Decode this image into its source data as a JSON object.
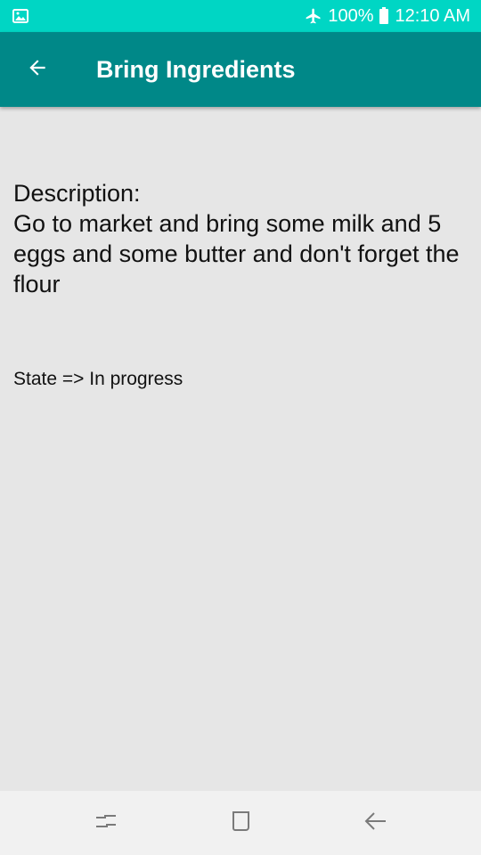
{
  "status_bar": {
    "battery_percent": "100%",
    "time": "12:10 AM",
    "icons": [
      "image-notification-icon",
      "airplane-mode-icon",
      "battery-icon"
    ]
  },
  "app_bar": {
    "title": "Bring Ingredients",
    "back_icon": "arrow-left-icon"
  },
  "task": {
    "description_label": "Description:",
    "description": "Go to market and bring some milk and 5 eggs and some butter and don't forget the flour",
    "state": "State => In progress"
  },
  "nav_bar": {
    "icons": [
      "recent-apps-icon",
      "home-icon",
      "back-icon"
    ]
  },
  "colors": {
    "status_bar": "#00d6c4",
    "app_bar": "#008888",
    "background": "#e6e6e6",
    "nav_bar": "#f1f1f1"
  }
}
